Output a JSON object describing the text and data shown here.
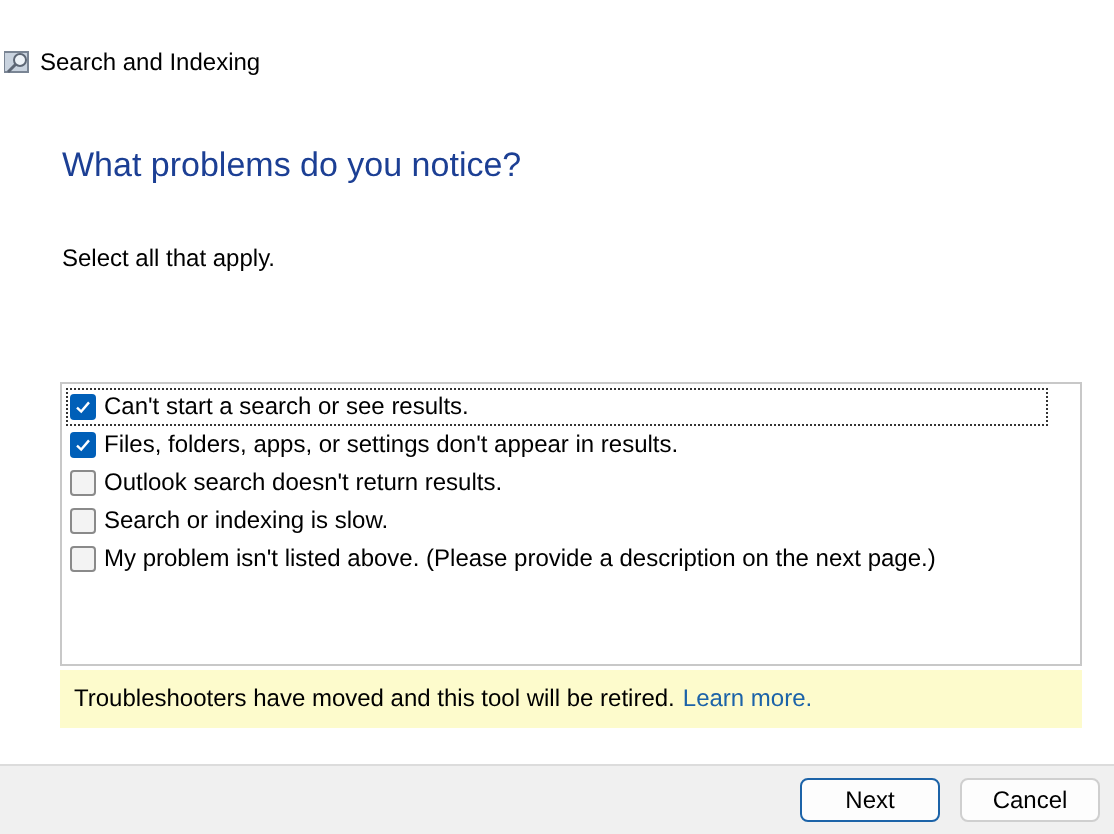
{
  "window": {
    "title": "Search and Indexing"
  },
  "heading": "What problems do you notice?",
  "instruction": "Select all that apply.",
  "problems": [
    {
      "label": "Can't start a search or see results.",
      "checked": true,
      "focused": true
    },
    {
      "label": "Files, folders, apps, or settings don't appear in results.",
      "checked": true,
      "focused": false
    },
    {
      "label": "Outlook search doesn't return results.",
      "checked": false,
      "focused": false
    },
    {
      "label": "Search or indexing is slow.",
      "checked": false,
      "focused": false
    },
    {
      "label": "My problem isn't listed above. (Please provide a description on the next page.)",
      "checked": false,
      "focused": false
    }
  ],
  "notice": {
    "text": "Troubleshooters have moved and this tool will be retired.",
    "link": "Learn more."
  },
  "buttons": [
    {
      "label": "Next",
      "default": true
    },
    {
      "label": "Cancel",
      "default": false
    }
  ]
}
